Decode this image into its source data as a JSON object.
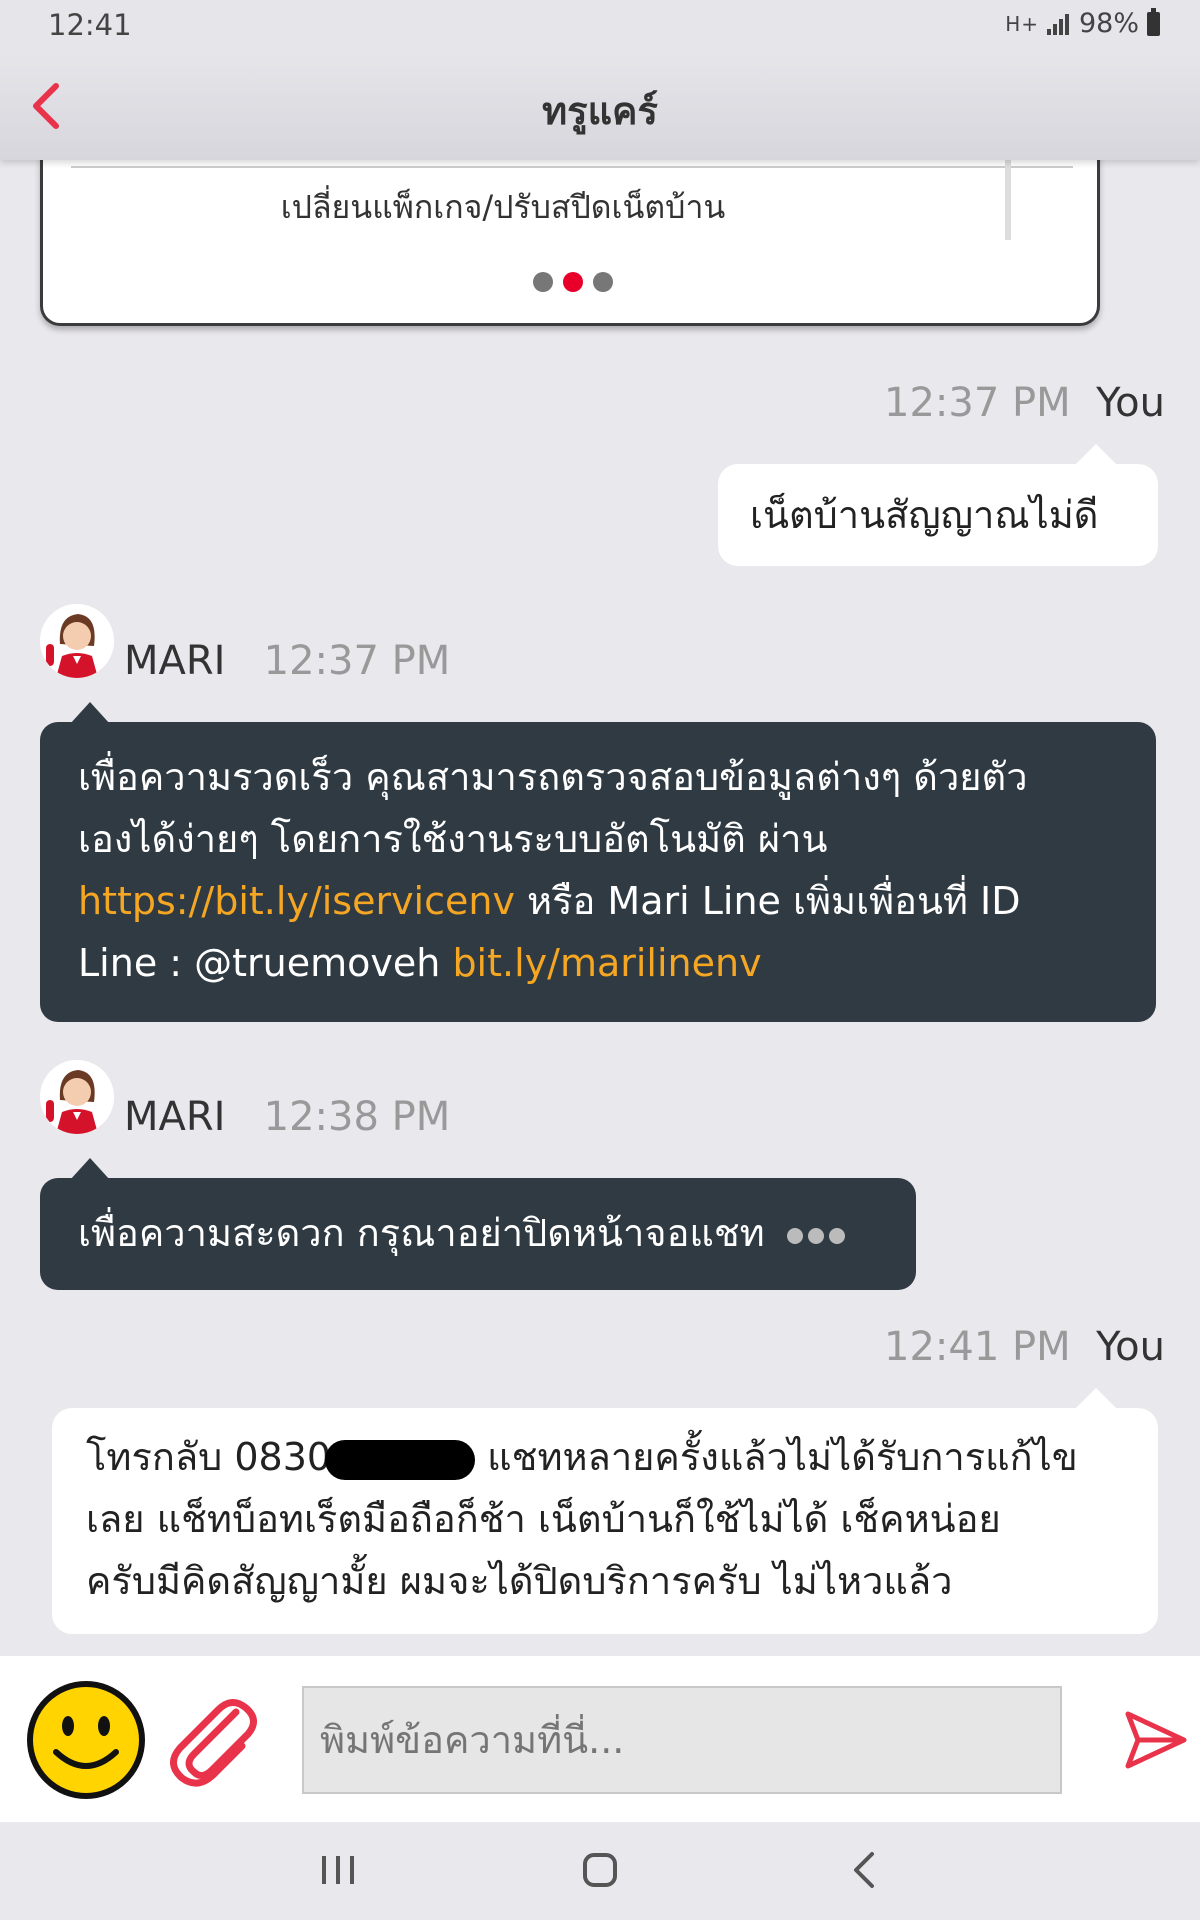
{
  "status": {
    "time": "12:41",
    "network": "H+",
    "battery": "98%"
  },
  "header": {
    "title": "ทรูแคร์"
  },
  "card": {
    "label": "เปลี่ยนแพ็กเกจ/ปรับสปีดเน็ตบ้าน",
    "dots_total": 3,
    "dots_active": 2
  },
  "messages": [
    {
      "sender": "You",
      "time": "12:37 PM",
      "text": "เน็ตบ้านสัญญาณไม่ดี"
    },
    {
      "sender": "MARI",
      "time": "12:37 PM",
      "text_1": "เพื่อความรวดเร็ว คุณสามารถตรวจสอบข้อมูลต่างๆ ด้วยตัว",
      "text_2": "เองได้ง่ายๆ โดยการใช้งานระบบอัตโนมัติ ผ่าน",
      "link_1": "https://bit.ly/iservicenv",
      "text_3": " หรือ Mari Line เพิ่มเพื่อนที่ ID",
      "text_4": "Line : @truemoveh ",
      "link_2": "bit.ly/marilinenv"
    },
    {
      "sender": "MARI",
      "time": "12:38 PM",
      "text": "เพื่อความสะดวก กรุณาอย่าปิดหน้าจอแชท"
    },
    {
      "sender": "You",
      "time": "12:41 PM",
      "line_1_a": "โทรกลับ 0830",
      "line_1_b": " แชทหลายครั้งแล้วไม่ได้รับการแก้ไข",
      "line_2": "เลย แช็ทบ็อทเร็ตมือถือก็ช้า เน็ตบ้านก็ใช้ไม่ได้ เช็คหน่อย",
      "line_3": "ครับมีคิดสัญญามั้ย ผมจะได้ปิดบริการครับ ไม่ไหวแล้ว"
    }
  ],
  "composer": {
    "placeholder": "พิมพ์ข้อความที่นี่..."
  },
  "icons": {
    "back": "chevron-left-icon",
    "emoji": "smiley-icon",
    "attach": "paperclip-icon",
    "send": "send-icon",
    "nav_recent": "recent-apps-icon",
    "nav_home": "home-icon",
    "nav_back": "nav-back-icon"
  },
  "colors": {
    "accent": "#e8334a",
    "bot_bubble": "#2f3a42",
    "link": "#f5a623",
    "background": "#e9e8ed"
  }
}
